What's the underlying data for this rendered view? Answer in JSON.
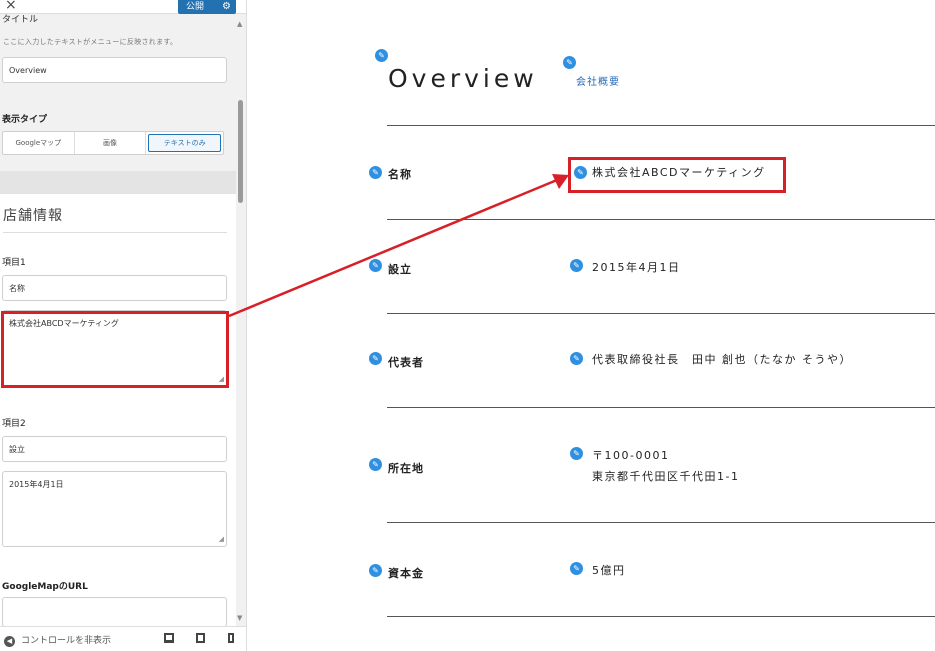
{
  "topbar": {
    "close_icon": "×",
    "publish_label": "公開",
    "gear_icon": "⚙"
  },
  "panel": {
    "cut_label": "タイトル",
    "hint": "ここに入力したテキストがメニューに反映されます。",
    "title_value": "Overview",
    "display_type_label": "表示タイプ",
    "display_options": [
      "Googleマップ",
      "画像",
      "テキストのみ"
    ],
    "selected_option": "テキストのみ",
    "section_heading": "店舗情報",
    "item1_label": "項目1",
    "item1_name": "名称",
    "item1_value": "株式会社ABCDマーケティング",
    "item2_label": "項目2",
    "item2_name": "設立",
    "item2_value": "2015年4月1日",
    "map_url_label": "GoogleMapのURL",
    "map_url_value": "",
    "hide_controls": "コントロールを非表示"
  },
  "preview": {
    "title": "Overview",
    "subtitle": "会社概要",
    "rows": [
      {
        "label": "名称",
        "value": "株式会社ABCDマーケティング"
      },
      {
        "label": "設立",
        "value": "2015年4月1日"
      },
      {
        "label": "代表者",
        "value": "代表取締役社長　田中 創也（たなか そうや）"
      },
      {
        "label": "所在地",
        "value": "〒100-0001",
        "value2": "東京都千代田区千代田1-1"
      },
      {
        "label": "資本金",
        "value": "5億円"
      }
    ]
  },
  "colors": {
    "accent": "#2271b1",
    "highlight": "#d72027",
    "edit_icon": "#2f8fe0"
  }
}
